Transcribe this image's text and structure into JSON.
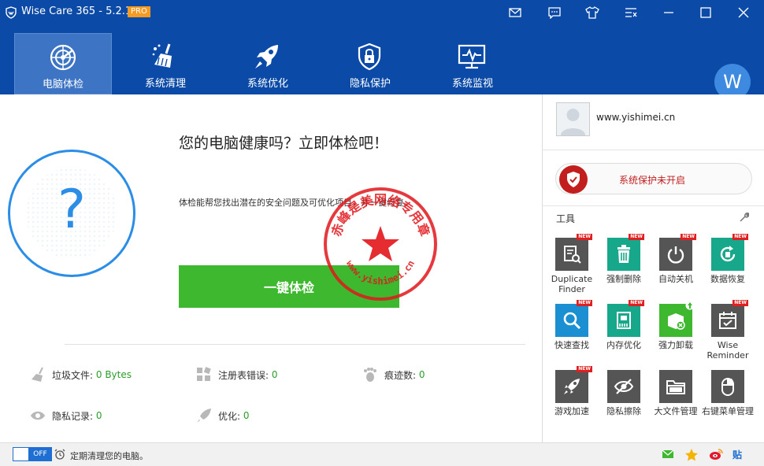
{
  "app": {
    "title": "Wise Care 365 - 5.2.1",
    "badge": "PRO",
    "avatar_letter": "W"
  },
  "nav": [
    {
      "label": "电脑体检",
      "icon": "radar-icon",
      "active": true
    },
    {
      "label": "系统清理",
      "icon": "broom-icon"
    },
    {
      "label": "系统优化",
      "icon": "rocket-icon"
    },
    {
      "label": "隐私保护",
      "icon": "lock-icon"
    },
    {
      "label": "系统监视",
      "icon": "monitor-icon"
    }
  ],
  "main": {
    "headline": "您的电脑健康吗？立即体检吧！",
    "description": "体检能帮您找出潜在的安全问题及可优化项目，并一键修复。",
    "scan_button": "一键体检",
    "stats": [
      {
        "label": "垃圾文件:",
        "value": "0 Bytes"
      },
      {
        "label": "注册表错误:",
        "value": "0"
      },
      {
        "label": "痕迹数:",
        "value": "0"
      },
      {
        "label": "隐私记录:",
        "value": "0"
      },
      {
        "label": "优化:",
        "value": "0"
      }
    ]
  },
  "stamp": {
    "text": "赤峰是美网络专用章",
    "url": "www.yishimei.cn"
  },
  "side": {
    "user": "www.yishimei.cn",
    "protection_status": "系统保护未开启",
    "tools_title": "工具",
    "tools": [
      {
        "label": "Duplicate Finder",
        "icon": "duplicate-finder-icon",
        "new": true
      },
      {
        "label": "强制删除",
        "icon": "trash-icon",
        "new": true
      },
      {
        "label": "自动关机",
        "icon": "power-icon",
        "new": true
      },
      {
        "label": "数据恢复",
        "icon": "data-recovery-icon",
        "new": true
      },
      {
        "label": "快速查找",
        "icon": "search-icon",
        "new": true
      },
      {
        "label": "内存优化",
        "icon": "memory-icon",
        "new": true
      },
      {
        "label": "强力卸载",
        "icon": "uninstall-icon",
        "new": false
      },
      {
        "label": "Wise Reminder",
        "icon": "calendar-icon",
        "new": true
      },
      {
        "label": "游戏加速",
        "icon": "game-rocket-icon",
        "new": true
      },
      {
        "label": "隐私擦除",
        "icon": "eye-slash-icon",
        "new": false
      },
      {
        "label": "大文件管理",
        "icon": "folder-icon",
        "new": false
      },
      {
        "label": "右键菜单管理",
        "icon": "mouse-icon",
        "new": false
      }
    ],
    "new_badge": "NEW"
  },
  "bottom": {
    "toggle": "OFF",
    "text": "定期清理您的电脑。",
    "paste": "贴"
  },
  "colors": {
    "accent": "#0b4aa6",
    "green": "#3db82f",
    "red": "#c21e1e",
    "teal": "#17a78a"
  }
}
